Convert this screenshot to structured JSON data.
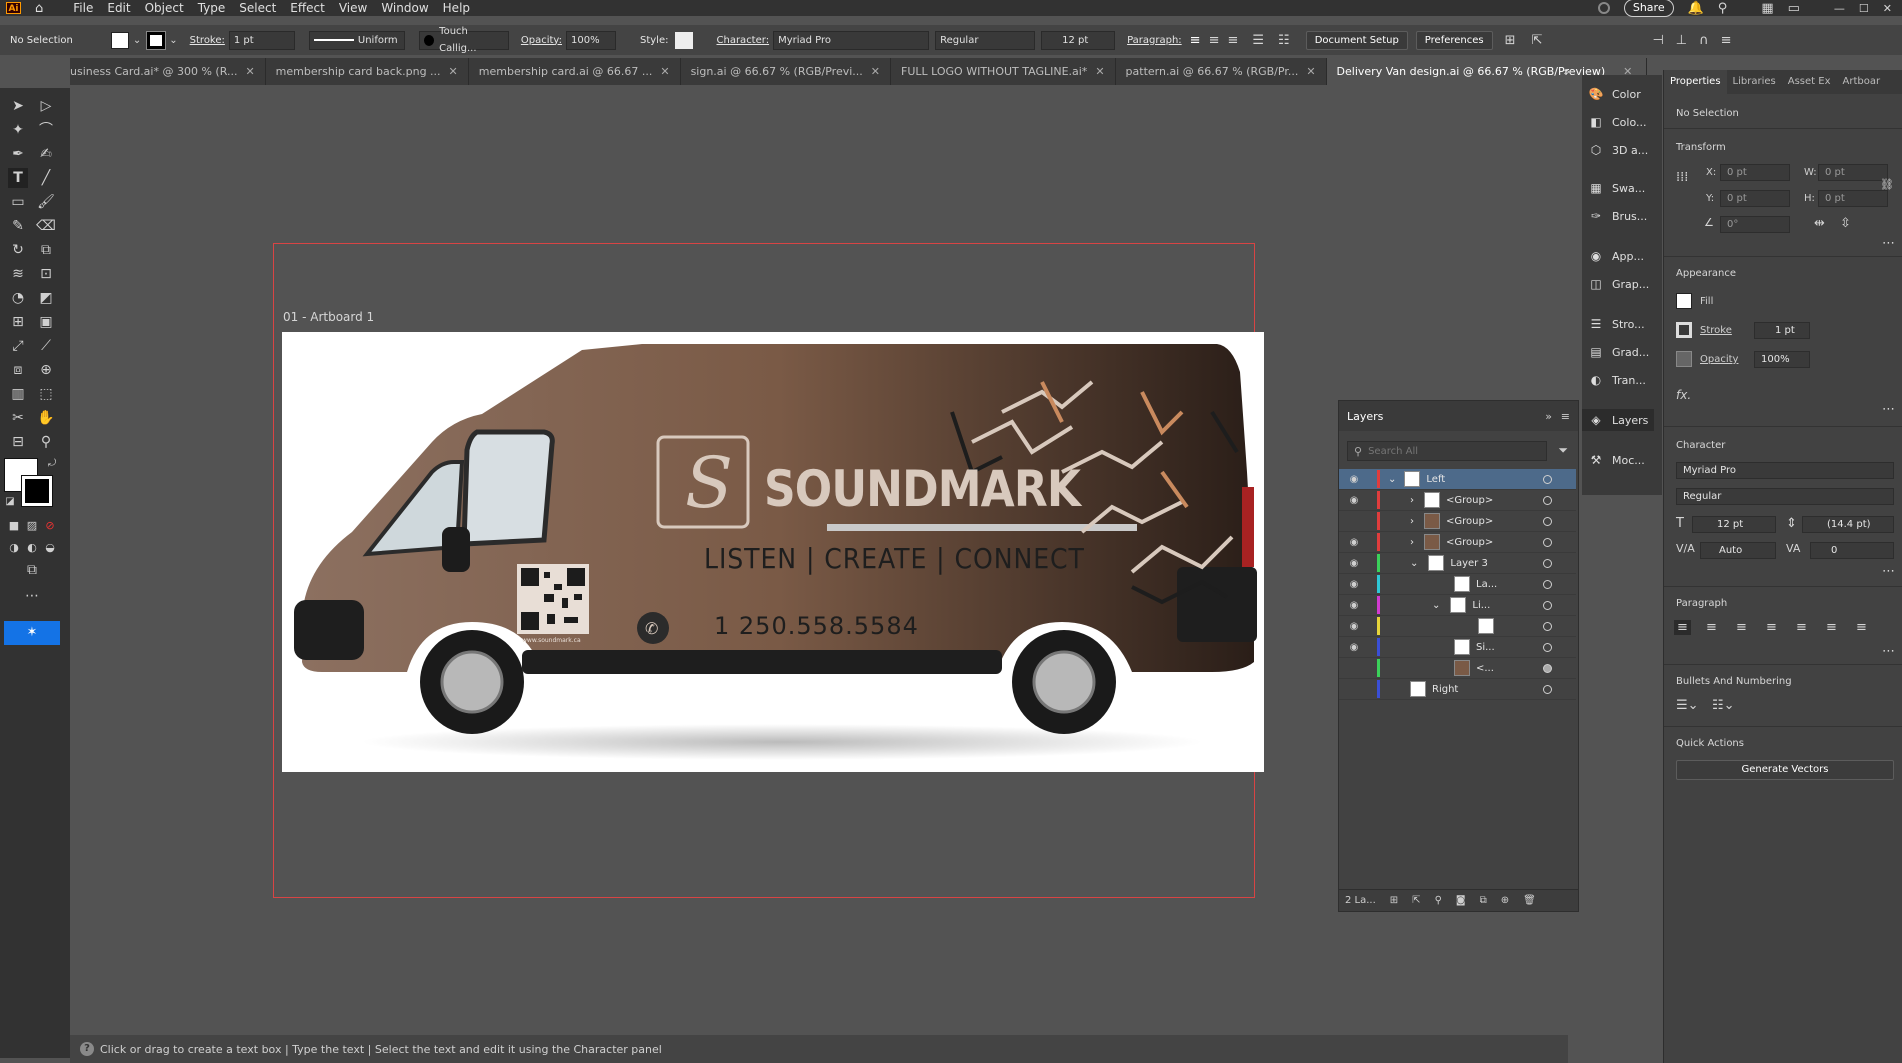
{
  "app": {
    "logo": "Ai",
    "menu": [
      "File",
      "Edit",
      "Object",
      "Type",
      "Select",
      "Effect",
      "View",
      "Window",
      "Help"
    ],
    "share_label": "Share"
  },
  "control_bar": {
    "selection": "No Selection",
    "stroke_label": "Stroke:",
    "stroke_weight": "1 pt",
    "stroke_profile": "Uniform",
    "brush": "Touch Callig...",
    "opacity_label": "Opacity:",
    "opacity_value": "100%",
    "style_label": "Style:",
    "character_label": "Character:",
    "font_family": "Myriad Pro",
    "font_style": "Regular",
    "font_size": "12 pt",
    "paragraph_label": "Paragraph:",
    "document_setup": "Document Setup",
    "preferences": "Preferences"
  },
  "tabs": [
    {
      "label": "usiness Card.ai* @ 300 % (R..."
    },
    {
      "label": "membership card back.png ..."
    },
    {
      "label": "membership card.ai @ 66.67 ..."
    },
    {
      "label": "sign.ai @ 66.67 % (RGB/Previ..."
    },
    {
      "label": "FULL LOGO WITHOUT TAGLINE.ai*"
    },
    {
      "label": "pattern.ai @ 66.67 % (RGB/Pr..."
    },
    {
      "label": "Delivery Van design.ai @ 66.67 % (RGB/Preview)",
      "active": true
    }
  ],
  "canvas": {
    "artboard_label": "01 - Artboard 1",
    "artwork": {
      "brand": "SOUNDMARK",
      "tagline": "LISTEN | CREATE | CONNECT",
      "phone": "1 250.558.5584",
      "website": "www.soundmark.ca"
    }
  },
  "status": {
    "text": "Click or drag to create a text box  |  Type the text  |  Select the text and edit it using the Character panel"
  },
  "layers_panel": {
    "title": "Layers",
    "search_placeholder": "Search All",
    "layers_count": "2 La...",
    "rows": [
      {
        "name": "Left",
        "color": "#e03d3d",
        "visible": true,
        "selected": true
      },
      {
        "name": "<Group>",
        "color": "#e03d3d",
        "visible": true
      },
      {
        "name": "<Group>",
        "color": "#e03d3d",
        "visible": false
      },
      {
        "name": "<Group>",
        "color": "#e03d3d",
        "visible": true
      },
      {
        "name": "Layer 3",
        "color": "#3bd15a",
        "visible": true
      },
      {
        "name": "La...",
        "color": "#2ec7d6",
        "visible": true
      },
      {
        "name": "Li...",
        "color": "#d23bd1",
        "visible": true
      },
      {
        "name": "",
        "color": "#e6d43a",
        "visible": true
      },
      {
        "name": "Si...",
        "color": "#3a4fd6",
        "visible": true
      },
      {
        "name": "<...",
        "color": "#3bd15a",
        "visible": false
      },
      {
        "name": "Right",
        "color": "#3a4fd6",
        "visible": false
      }
    ]
  },
  "dock": {
    "items": [
      "Color",
      "Colo...",
      "3D a...",
      "Swa...",
      "Brus...",
      "App...",
      "Grap...",
      "Stro...",
      "Grad...",
      "Tran...",
      "Layers",
      "Moc..."
    ]
  },
  "properties": {
    "tabs": [
      "Properties",
      "Libraries",
      "Asset Ex",
      "Artboar"
    ],
    "no_selection": "No Selection",
    "transform_title": "Transform",
    "x_label": "X:",
    "x_value": "0 pt",
    "y_label": "Y:",
    "y_value": "0 pt",
    "w_label": "W:",
    "w_value": "0 pt",
    "h_label": "H:",
    "h_value": "0 pt",
    "angle_value": "0°",
    "appearance_title": "Appearance",
    "fill_label": "Fill",
    "stroke_label": "Stroke",
    "stroke_value": "1 pt",
    "opacity_label": "Opacity",
    "opacity_value": "100%",
    "fx_label": "fx.",
    "character_title": "Character",
    "font_family": "Myriad Pro",
    "font_style": "Regular",
    "font_size": "12 pt",
    "leading": "(14.4 pt)",
    "kerning": "Auto",
    "tracking": "0",
    "paragraph_title": "Paragraph",
    "bullets_title": "Bullets And Numbering",
    "quick_actions_title": "Quick Actions",
    "generate_vectors": "Generate Vectors"
  }
}
